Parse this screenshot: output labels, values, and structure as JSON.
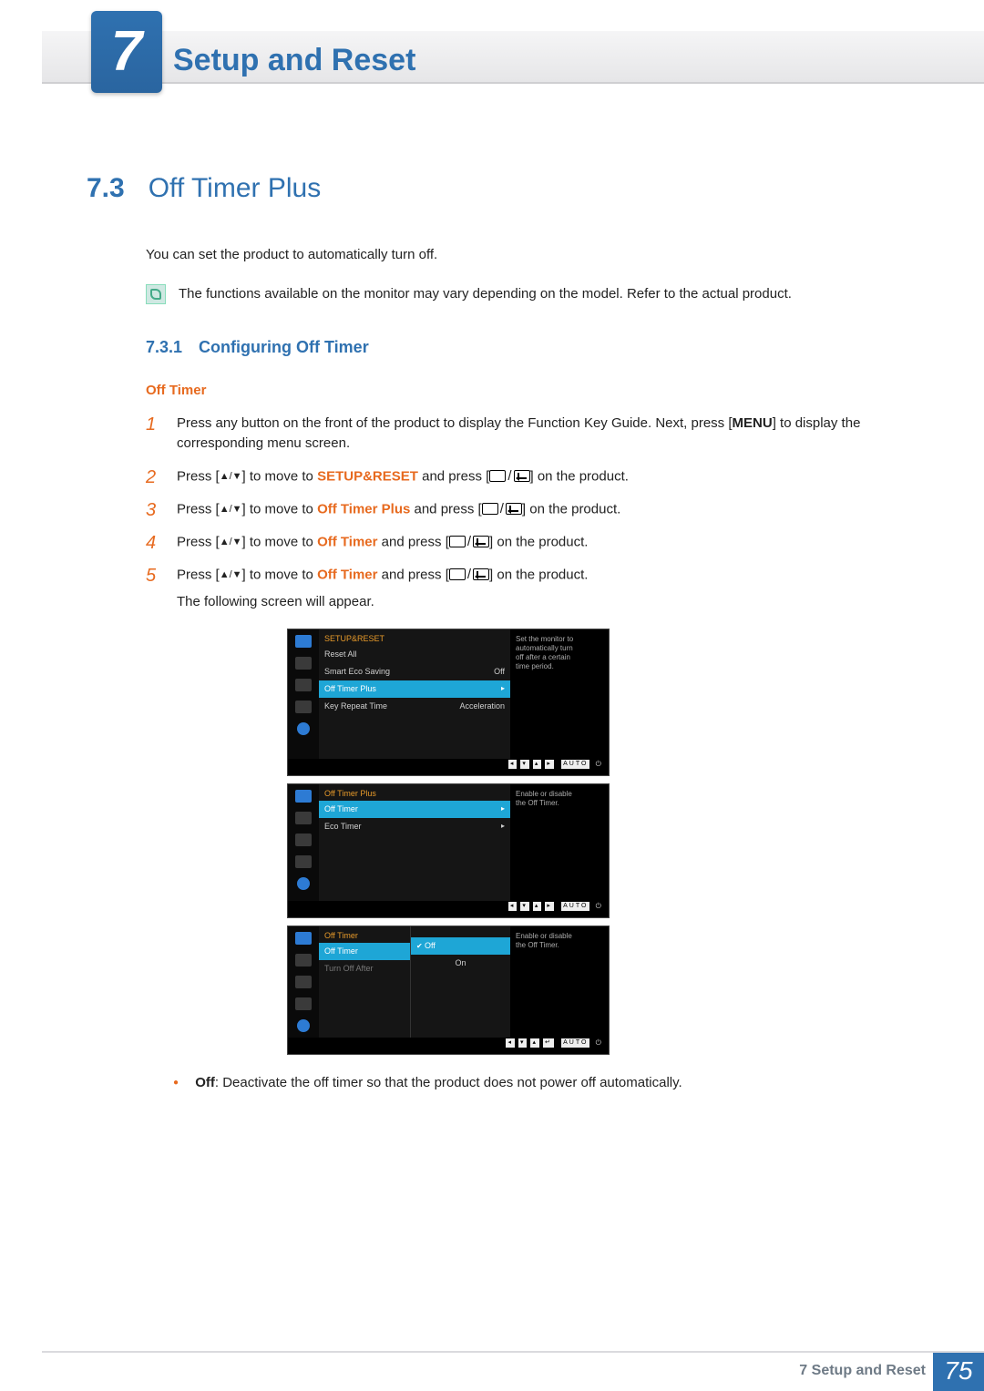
{
  "chapter": {
    "number": "7",
    "title": "Setup and Reset"
  },
  "section": {
    "number": "7.3",
    "title": "Off Timer Plus"
  },
  "intro": "You can set the product to automatically turn off.",
  "note": "The functions available on the monitor may vary depending on the model. Refer to the actual product.",
  "subsection": {
    "number": "7.3.1",
    "title": "Configuring Off Timer"
  },
  "heading4": "Off Timer",
  "steps": {
    "s1a": "Press any button on the front of the product to display the Function Key Guide. Next, press [",
    "s1_menu": "MENU",
    "s1b": "] to display the corresponding menu screen.",
    "s2a": "Press [",
    "s2b": "] to move to ",
    "s2kw": "SETUP&RESET",
    "s2c": " and press [",
    "s2d": "] on the product.",
    "s3a": "Press [",
    "s3b": "] to move to ",
    "s3kw": "Off Timer Plus",
    "s3c": " and press [",
    "s3d": "] on the product.",
    "s4a": "Press [",
    "s4b": "] to move to ",
    "s4kw": "Off Timer",
    "s4c": " and press [",
    "s4d": "] on the product.",
    "s5a": "Press [",
    "s5b": "] to move to ",
    "s5kw": "Off Timer",
    "s5c": " and press [",
    "s5d": "] on the product.",
    "s5e": "The following screen will appear."
  },
  "arrows_updown": "▲/▼",
  "bullet_off": {
    "kw": "Off",
    "text": ": Deactivate the off timer so that the product does not power off automatically."
  },
  "osd1": {
    "title": "SETUP&RESET",
    "help": "Set the monitor to automatically turn off after a certain time period.",
    "rows": [
      {
        "label": "Reset All",
        "value": ""
      },
      {
        "label": "Smart Eco Saving",
        "value": "Off"
      },
      {
        "label": "Off Timer Plus",
        "value": "▸",
        "selected": true
      },
      {
        "label": "Key Repeat Time",
        "value": "Acceleration"
      }
    ],
    "nav_auto": "AUTO"
  },
  "osd2": {
    "title": "Off Timer Plus",
    "help": "Enable or disable the Off Timer.",
    "rows": [
      {
        "label": "Off Timer",
        "value": "▸",
        "selected": true
      },
      {
        "label": "Eco Timer",
        "value": "▸"
      }
    ],
    "nav_auto": "AUTO"
  },
  "osd3": {
    "title": "Off Timer",
    "help": "Enable or disable the Off Timer.",
    "left": [
      {
        "label": "Off Timer",
        "selected": true
      },
      {
        "label": "Turn Off After",
        "dim": true
      }
    ],
    "right": [
      {
        "label": "Off",
        "selected": true,
        "check": true
      },
      {
        "label": "On"
      }
    ],
    "nav_auto": "AUTO"
  },
  "footer": {
    "label": "7 Setup and Reset",
    "page": "75"
  }
}
